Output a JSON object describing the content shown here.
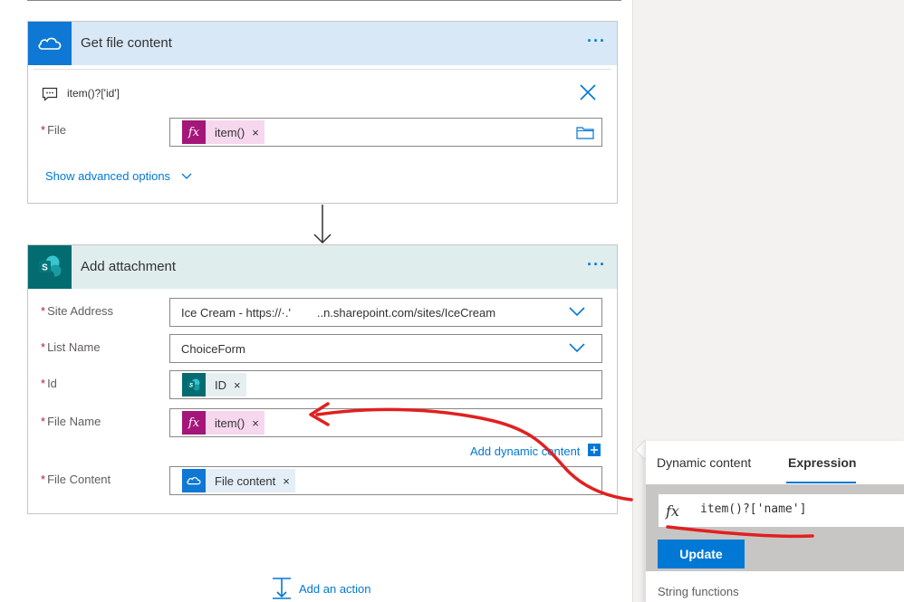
{
  "get_file_content": {
    "title": "Get file content",
    "more": "···",
    "id_expression": "item()?['id']",
    "file_label": "File",
    "file_token": "item()",
    "advanced_link": "Show advanced options"
  },
  "add_attachment": {
    "title": "Add attachment",
    "more": "···",
    "site_address_label": "Site Address",
    "site_address_value": "Ice Cream - https://·.'        ..n.sharepoint.com/sites/IceCream",
    "list_name_label": "List Name",
    "list_name_value": "ChoiceForm",
    "id_label": "Id",
    "id_token": "ID",
    "file_name_label": "File Name",
    "file_name_token": "item()",
    "add_dynamic_link": "Add dynamic content",
    "file_content_label": "File Content",
    "file_content_token": "File content"
  },
  "add_action": "Add an action",
  "expression_panel": {
    "tab_dynamic": "Dynamic content",
    "tab_expression": "Expression",
    "expression_value": "item()?['name']",
    "update_label": "Update",
    "section_label": "String functions"
  },
  "token_close": "×",
  "fx_glyph": "fx",
  "required_mark": "*",
  "icons": [
    "onedrive-icon",
    "sharepoint-icon",
    "comment-icon",
    "close-icon",
    "folder-icon",
    "chevron-down-icon",
    "add-action-icon"
  ],
  "colors": {
    "accent": "#0078d4",
    "onedrive_header": "#d9e8f6",
    "sharepoint_header": "#dfeded",
    "expression_token": "#a4167a",
    "annotation": "#e02020"
  }
}
